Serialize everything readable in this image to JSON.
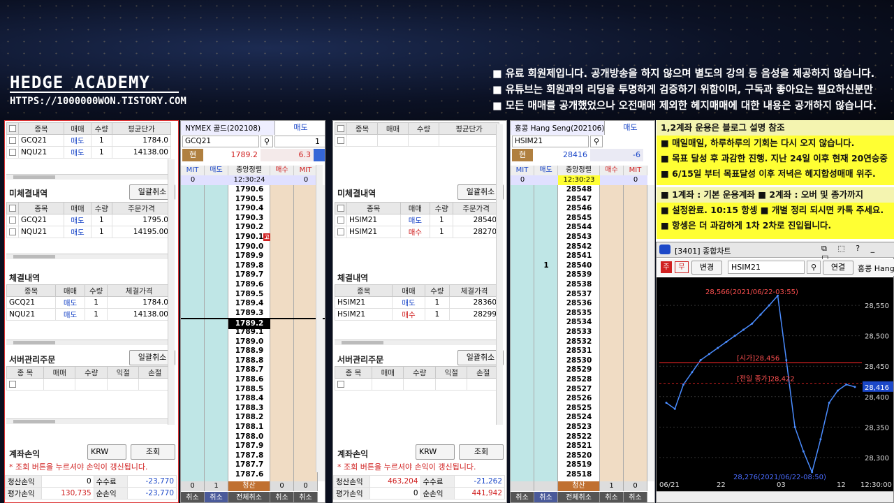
{
  "banner": {
    "logo": "HEDGE ACADEMY",
    "url": "HTTPS://1000000WON.TISTORY.COM",
    "notes": [
      "유료 회원제입니다. 공개방송을 하지 않으며 별도의 강의 등 음성을 제공하지 않습니다.",
      "유튜브는 회원과의 리딩을 투명하게 검증하기 위함이며, 구독과 좋아요는 필요하신분만",
      "모든 매매를 공개했었으나 오전매매 제외한 헤지매매에 대한 내용은 공개하지 않습니다."
    ]
  },
  "left": {
    "pos_headers": [
      "종목",
      "매매",
      "수량",
      "평균단가"
    ],
    "pos_rows": [
      [
        "GCQ21",
        "매도",
        "1",
        "1784.0"
      ],
      [
        "NQU21",
        "매도",
        "1",
        "14138.00"
      ]
    ],
    "unfilled_title": "미체결내역",
    "cancel_all": "일괄취소",
    "unf_headers": [
      "종목",
      "매매",
      "수량",
      "주문가격"
    ],
    "unf_rows": [
      [
        "GCQ21",
        "매도",
        "1",
        "1795.0"
      ],
      [
        "NQU21",
        "매도",
        "1",
        "14195.00"
      ]
    ],
    "filled_title": "체결내역",
    "fil_headers": [
      "종목",
      "매매",
      "수량",
      "체결가격"
    ],
    "fil_rows": [
      [
        "GCQ21",
        "매도",
        "1",
        "1784.0"
      ],
      [
        "NQU21",
        "매도",
        "1",
        "14138.00"
      ]
    ],
    "server_title": "서버관리주문",
    "srv_headers": [
      "종 목",
      "매매",
      "수량",
      "익절",
      "손절"
    ],
    "acct_title": "계좌손익",
    "currency": "KRW",
    "query": "조회",
    "warn": "* 조회 버튼을 누르셔야 손익이 갱신됩니다.",
    "liq_label": "청산손익",
    "liq_val": "0",
    "fee_label": "수수료",
    "fee_val": "-23,770",
    "eval_label": "평가손익",
    "eval_val": "130,735",
    "net_label": "순손익",
    "net_val": "-23,770"
  },
  "ladder1": {
    "title": "NYMEX 골드(202108)",
    "side": "매도",
    "code": "GCQ21",
    "qty": "1",
    "cur_label": "현",
    "price": "1789.2",
    "change": "6.3",
    "headers": [
      "MIT",
      "매도",
      "중앙정렬",
      "매수",
      "MIT"
    ],
    "top": [
      "0",
      "",
      "12:30:24",
      "",
      "0"
    ],
    "prices": [
      "1790.6",
      "1790.5",
      "1790.4",
      "1790.3",
      "1790.2",
      "1790.1",
      "1790.0",
      "1789.9",
      "1789.8",
      "1789.7",
      "1789.6",
      "1789.5",
      "1789.4",
      "1789.3",
      "1789.2",
      "1789.1",
      "1789.0",
      "1788.9",
      "1788.8",
      "1788.7",
      "1788.6",
      "1788.5",
      "1788.4",
      "1788.3",
      "1788.2",
      "1788.1",
      "1788.0",
      "1787.9",
      "1787.8",
      "1787.7",
      "1787.6"
    ],
    "marker": "고",
    "bottom": [
      "0",
      "1",
      "청산",
      "0",
      "0"
    ],
    "footer": [
      "취소",
      "취소",
      "전체취소",
      "취소",
      "취소"
    ]
  },
  "mid": {
    "pos_headers": [
      "종목",
      "매매",
      "수량",
      "평균단가"
    ],
    "unfilled_title": "미체결내역",
    "cancel_all": "일괄취소",
    "unf_headers": [
      "종목",
      "매매",
      "수량",
      "주문가격"
    ],
    "unf_rows": [
      [
        "HSIM21",
        "매도",
        "1",
        "28540"
      ],
      [
        "HSIM21",
        "매수",
        "1",
        "28270"
      ]
    ],
    "filled_title": "체결내역",
    "fil_headers": [
      "종목",
      "매매",
      "수량",
      "체결가격"
    ],
    "fil_rows": [
      [
        "HSIM21",
        "매도",
        "1",
        "28360"
      ],
      [
        "HSIM21",
        "매수",
        "1",
        "28299"
      ]
    ],
    "server_title": "서버관리주문",
    "srv_headers": [
      "종 목",
      "매매",
      "수량",
      "익절",
      "손절"
    ],
    "acct_title": "계좌손익",
    "currency": "KRW",
    "query": "조회",
    "warn": "* 조회 버튼을 누르셔야 손익이 갱신됩니다.",
    "liq_label": "청산손익",
    "liq_val": "463,204",
    "fee_label": "수수료",
    "fee_val": "-21,262",
    "eval_label": "평가손익",
    "eval_val": "0",
    "net_label": "순손익",
    "net_val": "441,942"
  },
  "ladder2": {
    "title": "홍콩 Hang Seng(202106)",
    "side": "매도",
    "code": "HSIM21",
    "cur_label": "현",
    "price": "28416",
    "change": "-6",
    "headers": [
      "MIT",
      "매도",
      "중앙정렬",
      "매수",
      "MIT"
    ],
    "top": [
      "0",
      "",
      "12:30:23",
      "",
      "0"
    ],
    "prices": [
      "28548",
      "28547",
      "28546",
      "28545",
      "28544",
      "28543",
      "28542",
      "28541",
      "28540",
      "28539",
      "28538",
      "28537",
      "28536",
      "28535",
      "28534",
      "28533",
      "28532",
      "28531",
      "28530",
      "28529",
      "28528",
      "28527",
      "28526",
      "28525",
      "28524",
      "28523",
      "28522",
      "28521",
      "28520",
      "28519",
      "28518"
    ],
    "ask_qty_row": "1",
    "bottom": [
      "",
      "",
      "청산",
      "1",
      "0"
    ],
    "footer": [
      "취소",
      "취소",
      "전체취소",
      "취소",
      "취소"
    ]
  },
  "right": {
    "y1_title": "1,2계좌 운용은 블로그 설명 참조",
    "y1_lines": [
      "매일매일, 하루하루의 기회는 다시 오지 않습니다.",
      "목표 달성 후 과감한 진행. 지난 24일 이후 현재 20연승중",
      "6/15일 부터 목표달성 이후 저녁은 헤지합성매매 위주."
    ],
    "y2_title": "■ 1계좌 : 기본 운용계좌 ■ 2계좌 : 오버 및 종가까지",
    "y2_lines": [
      "설정완료. 10:15 항셍 ■ 개별 정리 되시면 카톡 주세요.",
      "항셍은 더 과감하게 1차 2차로 진입됩니다."
    ]
  },
  "chart_win": {
    "title": "[3401] 종합차트",
    "change_btn": "변경",
    "symbol": "HSIM21",
    "link_btn": "연결",
    "name": "홍콩 Hang Se",
    "hi_label": "28,566(2021/06/22-03:55)",
    "open_label": "[시가]28,456",
    "prev_label": "[전일 종가]28,422",
    "lo_label": "28,276(2021/06/22-08:50)",
    "cur_tag": "28,416",
    "x_labels": [
      "06/21",
      "22",
      "03",
      "12",
      "12:30:00"
    ]
  },
  "chart_data": {
    "type": "line",
    "title": "종합차트 HSIM21",
    "ylim": [
      28270,
      28580
    ],
    "y_ticks": [
      28550,
      28500,
      28450,
      28400,
      28350,
      28300
    ],
    "x": [
      "06/21",
      "22",
      "03",
      "12",
      "12:30:00"
    ],
    "series": [
      {
        "name": "HSIM21",
        "values": [
          28390,
          28380,
          28420,
          28440,
          28460,
          28470,
          28480,
          28490,
          28500,
          28510,
          28520,
          28535,
          28550,
          28566,
          28460,
          28350,
          28310,
          28276,
          28330,
          28390,
          28410,
          28420,
          28416
        ]
      }
    ],
    "annotations": [
      "28,566(2021/06/22-03:55)",
      "[시가]28,456",
      "[전일 종가]28,422",
      "28,276(2021/06/22-08:50)"
    ]
  }
}
